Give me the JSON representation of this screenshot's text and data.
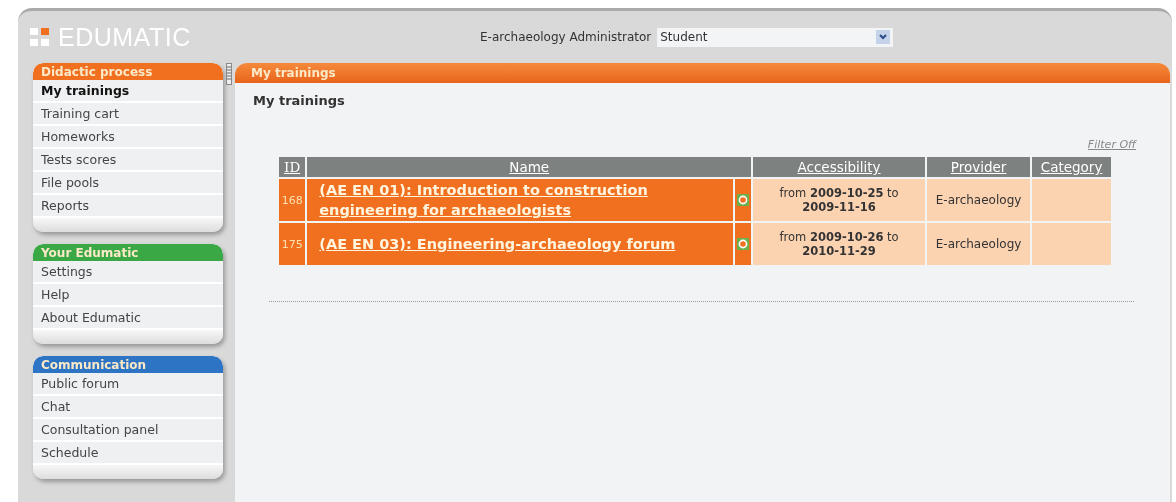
{
  "logo": "EDUMATIC",
  "header": {
    "label": "E-archaeology Administrator",
    "role_select": {
      "value": "Student"
    }
  },
  "sidebar": [
    {
      "title": "Didactic process",
      "color": "#f07020",
      "items": [
        {
          "label": "My trainings",
          "selected": true
        },
        {
          "label": "Training cart",
          "selected": false
        },
        {
          "label": "Homeworks",
          "selected": false
        },
        {
          "label": "Tests scores",
          "selected": false
        },
        {
          "label": "File pools",
          "selected": false
        },
        {
          "label": "Reports",
          "selected": false
        }
      ]
    },
    {
      "title": "Your Edumatic",
      "color": "#3aa845",
      "items": [
        {
          "label": "Settings",
          "selected": false
        },
        {
          "label": "Help",
          "selected": false
        },
        {
          "label": "About Edumatic",
          "selected": false
        }
      ]
    },
    {
      "title": "Communication",
      "color": "#2e74c4",
      "items": [
        {
          "label": "Public forum",
          "selected": false
        },
        {
          "label": "Chat",
          "selected": false
        },
        {
          "label": "Consultation panel",
          "selected": false
        },
        {
          "label": "Schedule",
          "selected": false
        }
      ]
    }
  ],
  "main": {
    "panel_title": "My trainings",
    "heading": "My trainings",
    "filter_link": "Filter Off",
    "table": {
      "columns": [
        "ID",
        "Name",
        "Accessibility",
        "Provider",
        "Category"
      ],
      "rows": [
        {
          "id": "168",
          "name": "(AE EN 01): Introduction to construction engineering for archaeologists",
          "accessibility": "from **2009-10-25** to **2009-11-16**",
          "provider": "E-archaeology"
        },
        {
          "id": "175",
          "name": "(AE EN 03): Engineering-archaeology forum",
          "accessibility": "from **2009-10-26** to **2010-11-29**",
          "provider": "E-archaeology"
        }
      ]
    }
  }
}
